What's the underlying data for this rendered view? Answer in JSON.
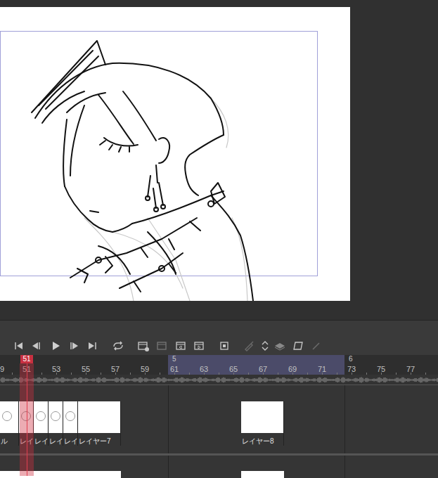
{
  "ruler": {
    "playhead": "51",
    "seconds": [
      "5",
      "6"
    ],
    "frames": [
      "9",
      "51",
      "53",
      "55",
      "57",
      "59",
      "61",
      "63",
      "65",
      "67",
      "69",
      "71",
      "73",
      "75",
      "77"
    ]
  },
  "tracks": [
    {
      "cells": [
        {
          "label": "ル"
        },
        {
          "label": "レイ"
        },
        {
          "label": "レイ"
        },
        {
          "label": "レイ"
        },
        {
          "label": "レイ"
        },
        {
          "label": "レイヤー7"
        },
        {
          "label": "レイヤー8"
        }
      ]
    }
  ]
}
